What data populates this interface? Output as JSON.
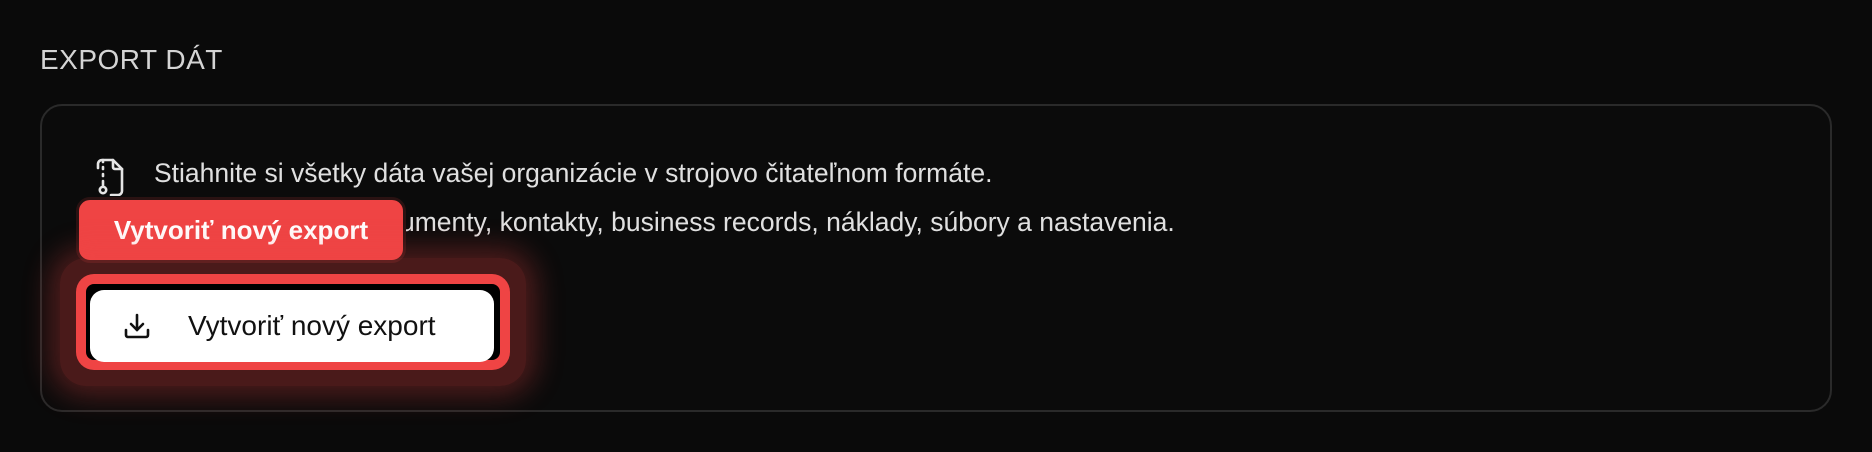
{
  "section": {
    "title": "EXPORT DÁT"
  },
  "card": {
    "icon": "file-archive-icon",
    "description_line1": "Stiahnite si všetky dáta vašej organizácie v strojovo čitateľnom formáte.",
    "description_line2": "Obsahuje všetky dokumenty, kontakty, business records, náklady, súbory a nastavenia."
  },
  "tooltip": {
    "label": "Vytvoriť nový export"
  },
  "export_button": {
    "label": "Vytvoriť nový export",
    "icon": "download-icon"
  },
  "colors": {
    "background": "#0a0a0a",
    "card_border": "#2a2a2a",
    "text": "#e0e0e0",
    "highlight": "#ef4444",
    "button_bg": "#ffffff"
  }
}
